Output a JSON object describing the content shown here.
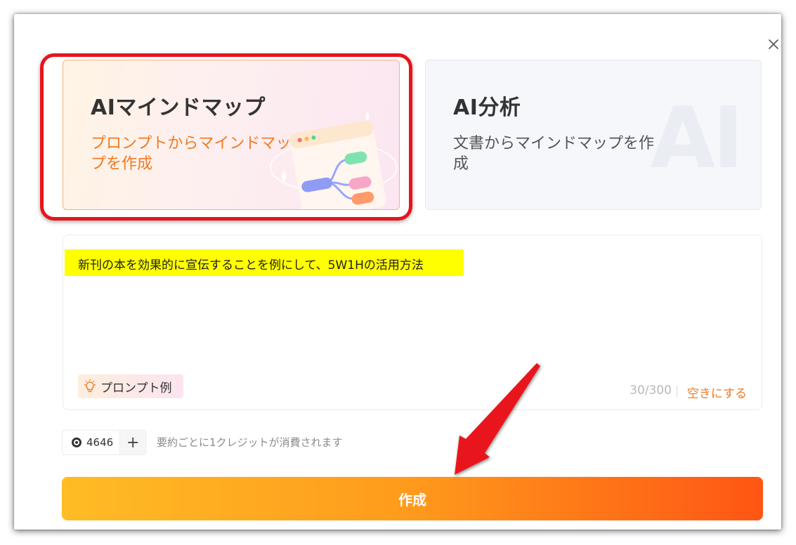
{
  "dialog": {
    "close_icon": "close-icon",
    "cards": [
      {
        "title": "AIマインドマップ",
        "description": "プロンプトからマインドマップを作成",
        "selected": true,
        "illustration_icon": "mind-map-illustration-icon"
      },
      {
        "title": "AI分析",
        "description": "文書からマインドマップを作成",
        "selected": false,
        "watermark": "AI"
      }
    ],
    "prompt": {
      "text": "新刊の本を効果的に宣伝することを例にして、5W1Hの活用方法",
      "example_button_label": "プロンプト例",
      "example_icon": "lightbulb-icon",
      "char_count": "30/300",
      "clear_label": "空きにする"
    },
    "credits": {
      "icon": "coin-icon",
      "value": "4646",
      "add_label": "+",
      "note": "要約ごとに1クレジットが消費されます"
    },
    "create_button_label": "作成"
  },
  "annotations": {
    "highlight_color": "#e8141c",
    "arrow_color": "#e8141c"
  },
  "colors": {
    "accent_orange": "#f07a22",
    "button_gradient_start": "#ffbc25",
    "button_gradient_end": "#ff5514"
  }
}
